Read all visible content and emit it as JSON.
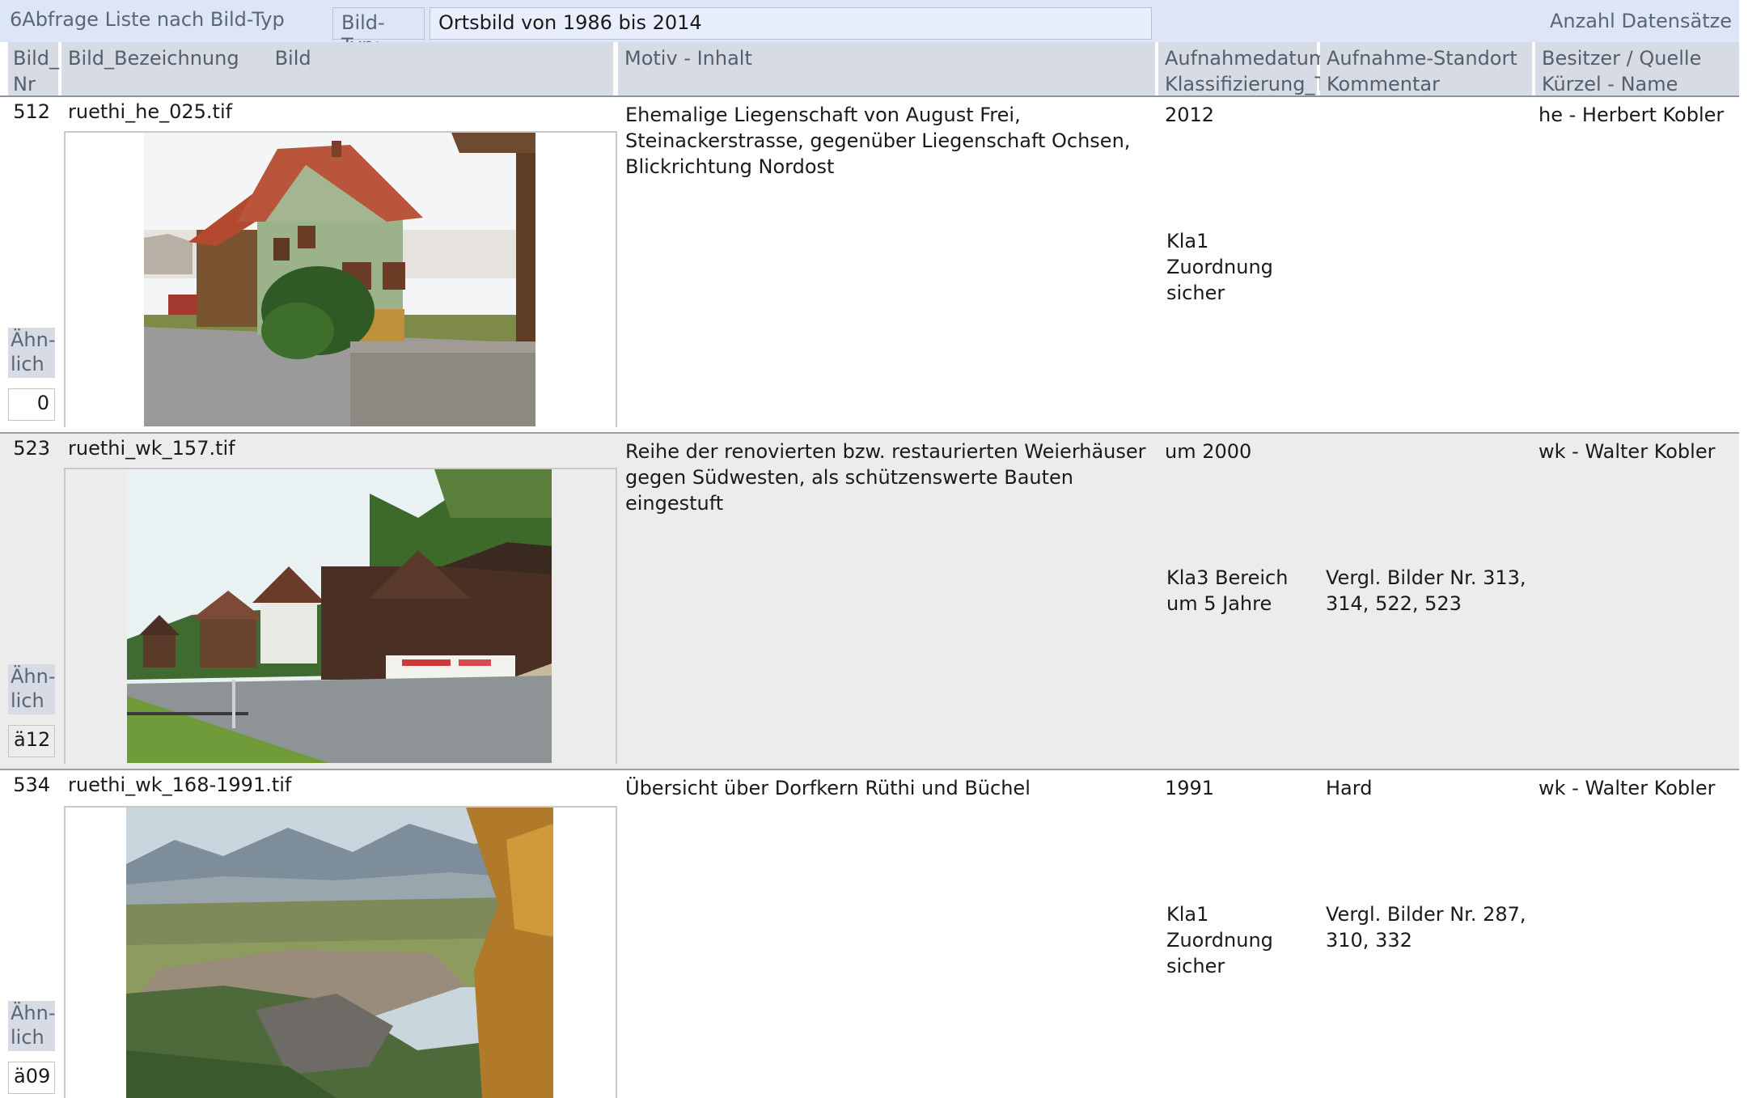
{
  "topbar": {
    "title": "6Abfrage Liste nach Bild-Typ",
    "filter_label": "Bild-Typ:",
    "filter_value": "Ortsbild von 1986 bis 2014",
    "count_label": "Anzahl Datensätze"
  },
  "headers": {
    "bild_nr": "Bild_ Nr",
    "bezeichnung": "Bild_Bezeichnung",
    "bild": "Bild",
    "motiv": "Motiv - Inhalt",
    "datum": "Aufnahmedatum Klassifizierung_T",
    "standort": "Aufnahme-Standort Kommentar",
    "besitzer": "Besitzer / Quelle Kürzel - Name"
  },
  "aehnlich_label": "Ähn- lich",
  "records": [
    {
      "nr": "512",
      "name": "ruethi_he_025.tif",
      "motiv": "Ehemalige Liegenschaft von  August Frei, Steinackerstrasse, gegenüber Liegenschaft Ochsen, Blickrichtung Nordost",
      "datum": "2012",
      "klass": "Kla1 Zuordnung sicher",
      "standort": "",
      "kommentar": "",
      "besitzer": "he - Herbert Kobler",
      "aehnlich": "0",
      "image": "green-farmhouse-photo"
    },
    {
      "nr": "523",
      "name": "ruethi_wk_157.tif",
      "motiv": "Reihe der renovierten bzw. restaurierten Weierhäuser gegen Südwesten, als schützenswerte Bauten eingestuft",
      "datum": "um 2000",
      "klass": "Kla3 Bereich um 5 Jahre",
      "standort": "",
      "kommentar": "Vergl. Bilder Nr. 313, 314, 522, 523",
      "besitzer": "wk - Walter Kobler",
      "aehnlich": "ä12",
      "image": "row-of-houses-photo"
    },
    {
      "nr": "534",
      "name": "ruethi_wk_168-1991.tif",
      "motiv": "Übersicht über Dorfkern Rüthi und Büchel",
      "datum": "1991",
      "klass": "Kla1 Zuordnung sicher",
      "standort": "Hard",
      "kommentar": "Vergl. Bilder Nr. 287, 310, 332",
      "besitzer": "wk - Walter Kobler",
      "aehnlich": "ä09",
      "image": "valley-panorama-photo"
    }
  ]
}
